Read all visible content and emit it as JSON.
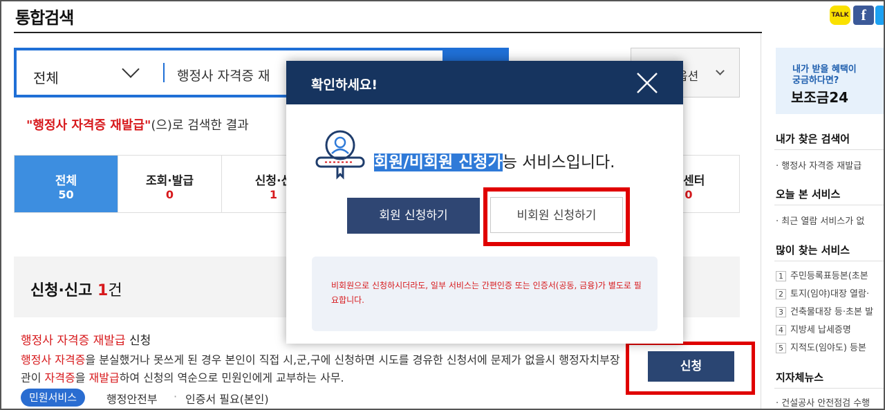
{
  "header": {
    "title": "통합검색",
    "share": [
      "TALK",
      "f"
    ]
  },
  "search": {
    "scope": "전체",
    "query": "행정사 자격증 재",
    "option_label": "옵션"
  },
  "result_message": {
    "keyword": "\"행정사 자격증 재발급\"",
    "rest": "(으)로 검색한 결과"
  },
  "tabs": [
    {
      "label": "전체",
      "count": "50"
    },
    {
      "label": "조회·발급",
      "count": "0"
    },
    {
      "label": "신청·신",
      "count": "1"
    },
    {
      "label": "백센터",
      "count": "0"
    }
  ],
  "section": {
    "title": "신청·신고",
    "count": "1",
    "unit": "건"
  },
  "result_item": {
    "title_keyword": "행정사 자격증 재발급",
    "title_suffix": " 신청",
    "desc_hl1": "행정사 자격증",
    "desc_part1": "을 분실했거나 못쓰게 된 경우 본인이 직접 시,군,구에 신청하면 시도를 경유한 신청서에 문제가 없을시 행정자치부장관이 ",
    "desc_hl2": "자격증",
    "desc_part2": "을 ",
    "desc_hl3": "재발급",
    "desc_part3": "하여 신청의 역순으로 민원인에게 교부하는 사무.",
    "badge": "민원서비스",
    "agency": "행정안전부",
    "dot": "·",
    "requirement": "인증서 필요(본인)",
    "apply_label": "신청"
  },
  "right_rail": {
    "ad_line1": "내가 받을 혜택이",
    "ad_line2": "궁금하다면?",
    "ad_brand": "보조금24",
    "my_search_title": "내가 찾은 검색어",
    "my_search_item": "· 행정사 자격증 재발급",
    "today_title": "오늘 본 서비스",
    "today_item": "· 최근 열람 서비스가 없",
    "popular_title": "많이 찾는 서비스",
    "popular": [
      {
        "num": "1",
        "label": "주민등록표등본(초본"
      },
      {
        "num": "2",
        "label": "토지(임야)대장 열람·"
      },
      {
        "num": "3",
        "label": "건축물대장 등·초본 발"
      },
      {
        "num": "4",
        "label": "지방세 납세증명"
      },
      {
        "num": "5",
        "label": "지적도(임야도) 등본"
      }
    ],
    "news_title": "지자체뉴스",
    "news_item": "· 건설공사 안전점검 수행"
  },
  "modal": {
    "title": "확인하세요!",
    "message_selected": "회원/비회원 신청가",
    "message_rest": "능 서비스입니다.",
    "member_button": "회원 신청하기",
    "guest_button": "비회원 신청하기",
    "notice": "비회원으로 신청하시더라도, 일부 서비스는 간편인증 또는 인증서(공동, 금융)가 별도로 필요합니다."
  }
}
